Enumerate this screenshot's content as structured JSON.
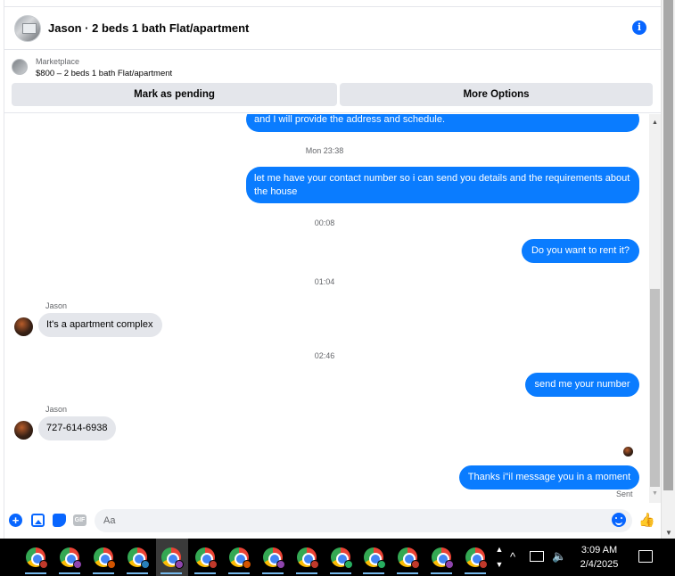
{
  "header": {
    "title": "Jason · 2 beds 1 bath Flat/apartment"
  },
  "listing": {
    "source": "Marketplace",
    "title": "$800 – 2 beds 1 bath Flat/apartment",
    "pending_button": "Mark as pending",
    "more_button": "More Options"
  },
  "messages": {
    "m1": "and I will provide the address and schedule.",
    "t1": "Mon 23:38",
    "m2": "let me have your contact number so i can send you details and the requirements about the house",
    "t2": "00:08",
    "m3": "Do you want to rent it?",
    "t3": "01:04",
    "sender1": "Jason",
    "m4": "It's a apartment complex",
    "t4": "02:46",
    "m5": "send me your number",
    "sender2": "Jason",
    "m6": "727-614-6938",
    "m7": "Thanks i\"il message you in a moment",
    "sent": "Sent"
  },
  "composer": {
    "placeholder": "Aa",
    "gif_label": "GIF"
  },
  "taskbar": {
    "time": "3:09 AM",
    "date": "2/4/2025",
    "app_badges": [
      "#c0392b",
      "#8e44ad",
      "#d35400",
      "#2980b9",
      "#8e44ad",
      "#c0392b",
      "#d35400",
      "#8e44ad",
      "#c0392b",
      "#27ae60",
      "#27ae60",
      "#c0392b",
      "#8e44ad",
      "#c0392b"
    ]
  },
  "colors": {
    "outgoing_bubble": "#0a7cff",
    "incoming_bubble": "#e4e6eb",
    "accent": "#0866ff"
  }
}
